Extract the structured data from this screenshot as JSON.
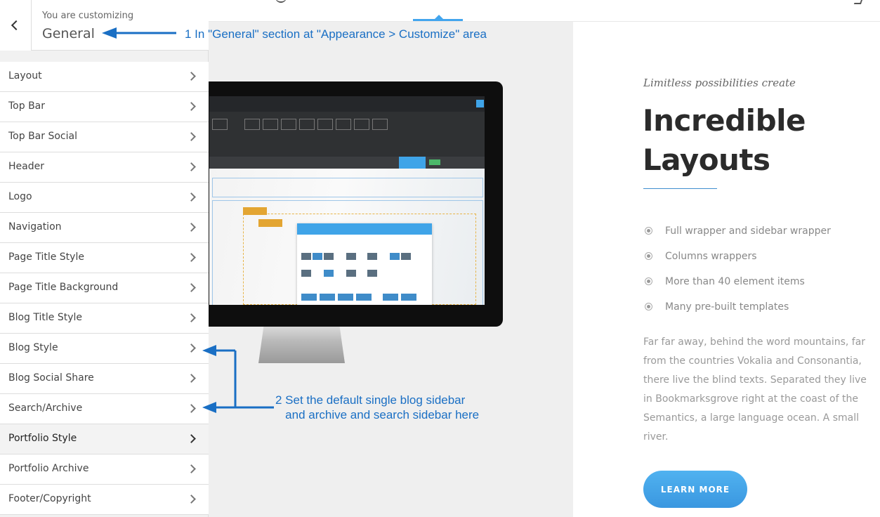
{
  "customizer": {
    "header_label": "You are customizing",
    "section_title": "General",
    "menu": [
      {
        "label": "Layout"
      },
      {
        "label": "Top Bar"
      },
      {
        "label": "Top Bar Social"
      },
      {
        "label": "Header"
      },
      {
        "label": "Logo"
      },
      {
        "label": "Navigation"
      },
      {
        "label": "Page Title Style"
      },
      {
        "label": "Page Title Background"
      },
      {
        "label": "Blog Title Style"
      },
      {
        "label": "Blog Style"
      },
      {
        "label": "Blog Social Share"
      },
      {
        "label": "Search/Archive"
      },
      {
        "label": "Portfolio Style"
      },
      {
        "label": "Portfolio Archive"
      },
      {
        "label": "Footer/Copyright"
      }
    ]
  },
  "preview": {
    "tagline": "Limitless possibilities create",
    "headline": "Incredible Layouts",
    "features": [
      "Full wrapper and sidebar wrapper",
      "Columns wrappers",
      "More than 40 element items",
      "Many pre-built templates"
    ],
    "paragraph": "Far far away, behind the word mountains, far from the countries Vokalia and Consonantia, there live the blind texts. Separated they live in Bookmarksgrove right at the coast of the Semantics, a large language ocean. A small river.",
    "button_label": "LEARN MORE"
  },
  "annotations": {
    "note1": "1 In \"General\" section at \"Appearance > Customize\" area",
    "note2": "2 Set the default single blog sidebar\n   and archive and search sidebar here"
  },
  "colors": {
    "accent": "#3fa4e8",
    "annotation": "#1a6fc4"
  }
}
